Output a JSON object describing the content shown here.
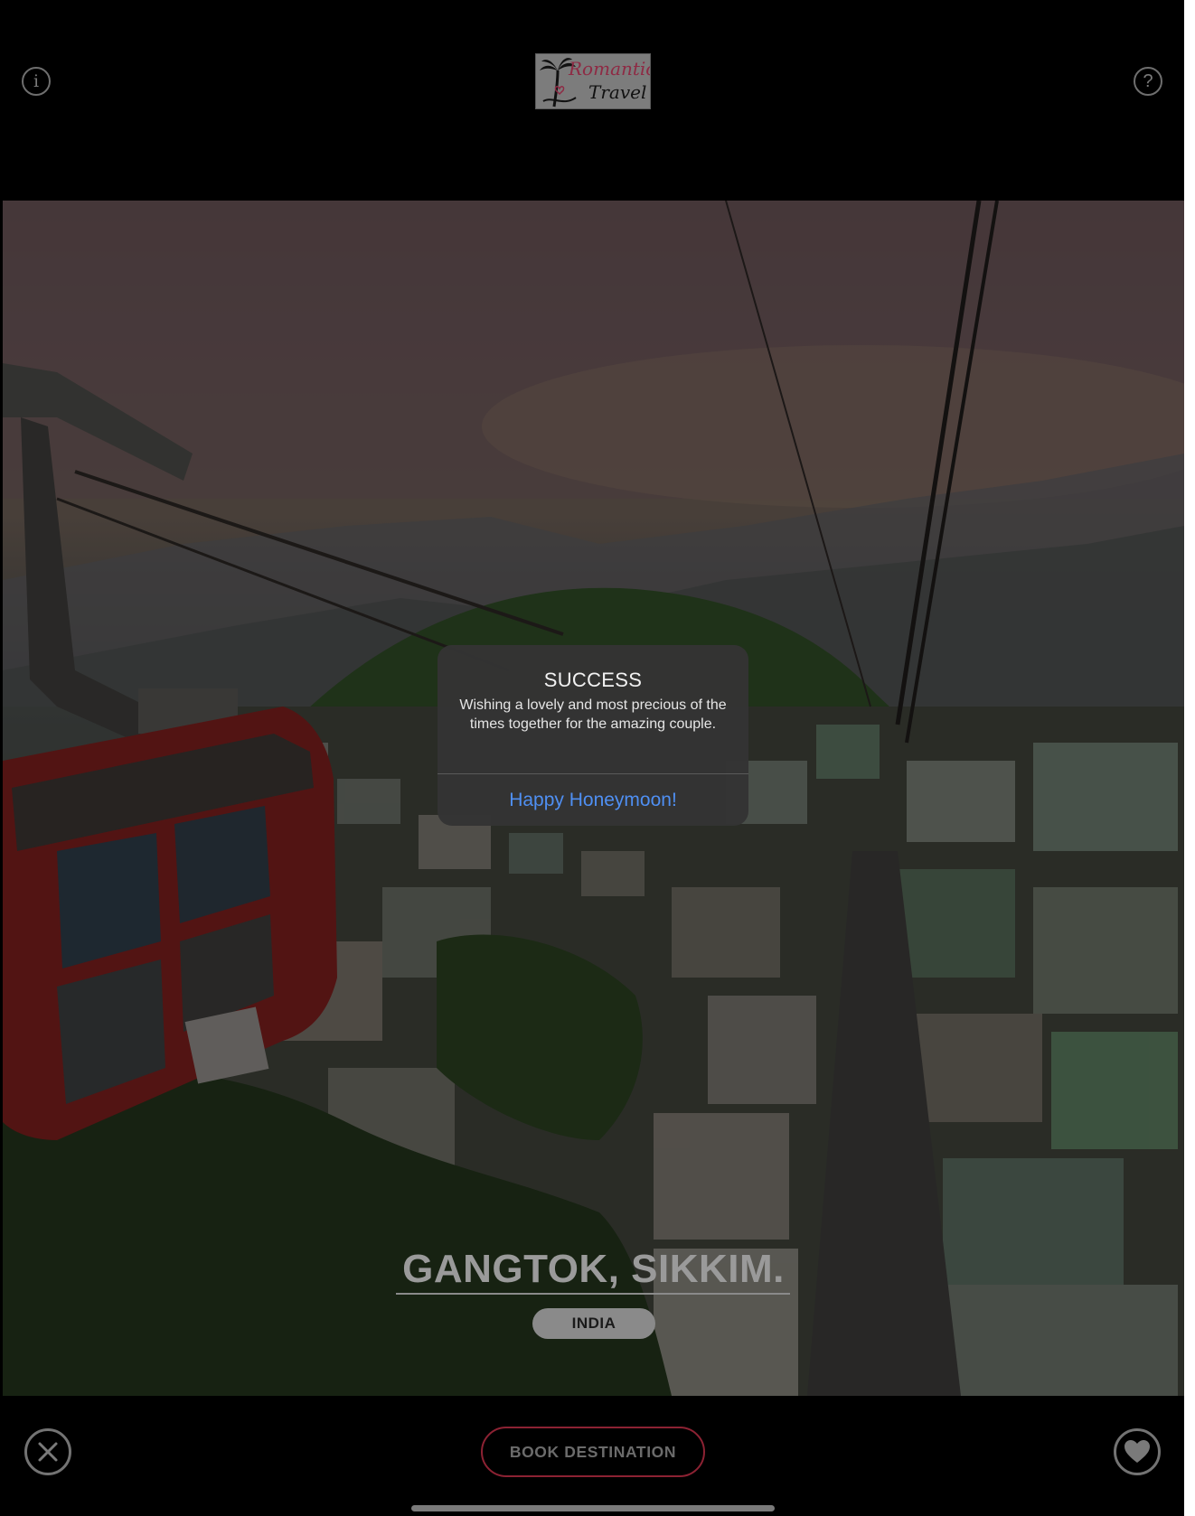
{
  "header": {
    "logo_line1": "Romantics",
    "logo_line2": "Travel",
    "info_icon": "info-circle-icon",
    "help_icon": "question-circle-icon"
  },
  "destination": {
    "title": "GANGTOK, SIKKIM.",
    "country": "INDIA"
  },
  "alert": {
    "title": "SUCCESS",
    "message": "Wishing a lovely and most precious of the times together for the amazing couple.",
    "button": "Happy Honeymoon!"
  },
  "footer": {
    "book_label": "BOOK DESTINATION",
    "close_icon": "close-circle-icon",
    "favorite_icon": "heart-circle-icon"
  },
  "colors": {
    "alert_button": "#4f8ff2",
    "book_border": "#8c2233",
    "background": "#000000"
  }
}
